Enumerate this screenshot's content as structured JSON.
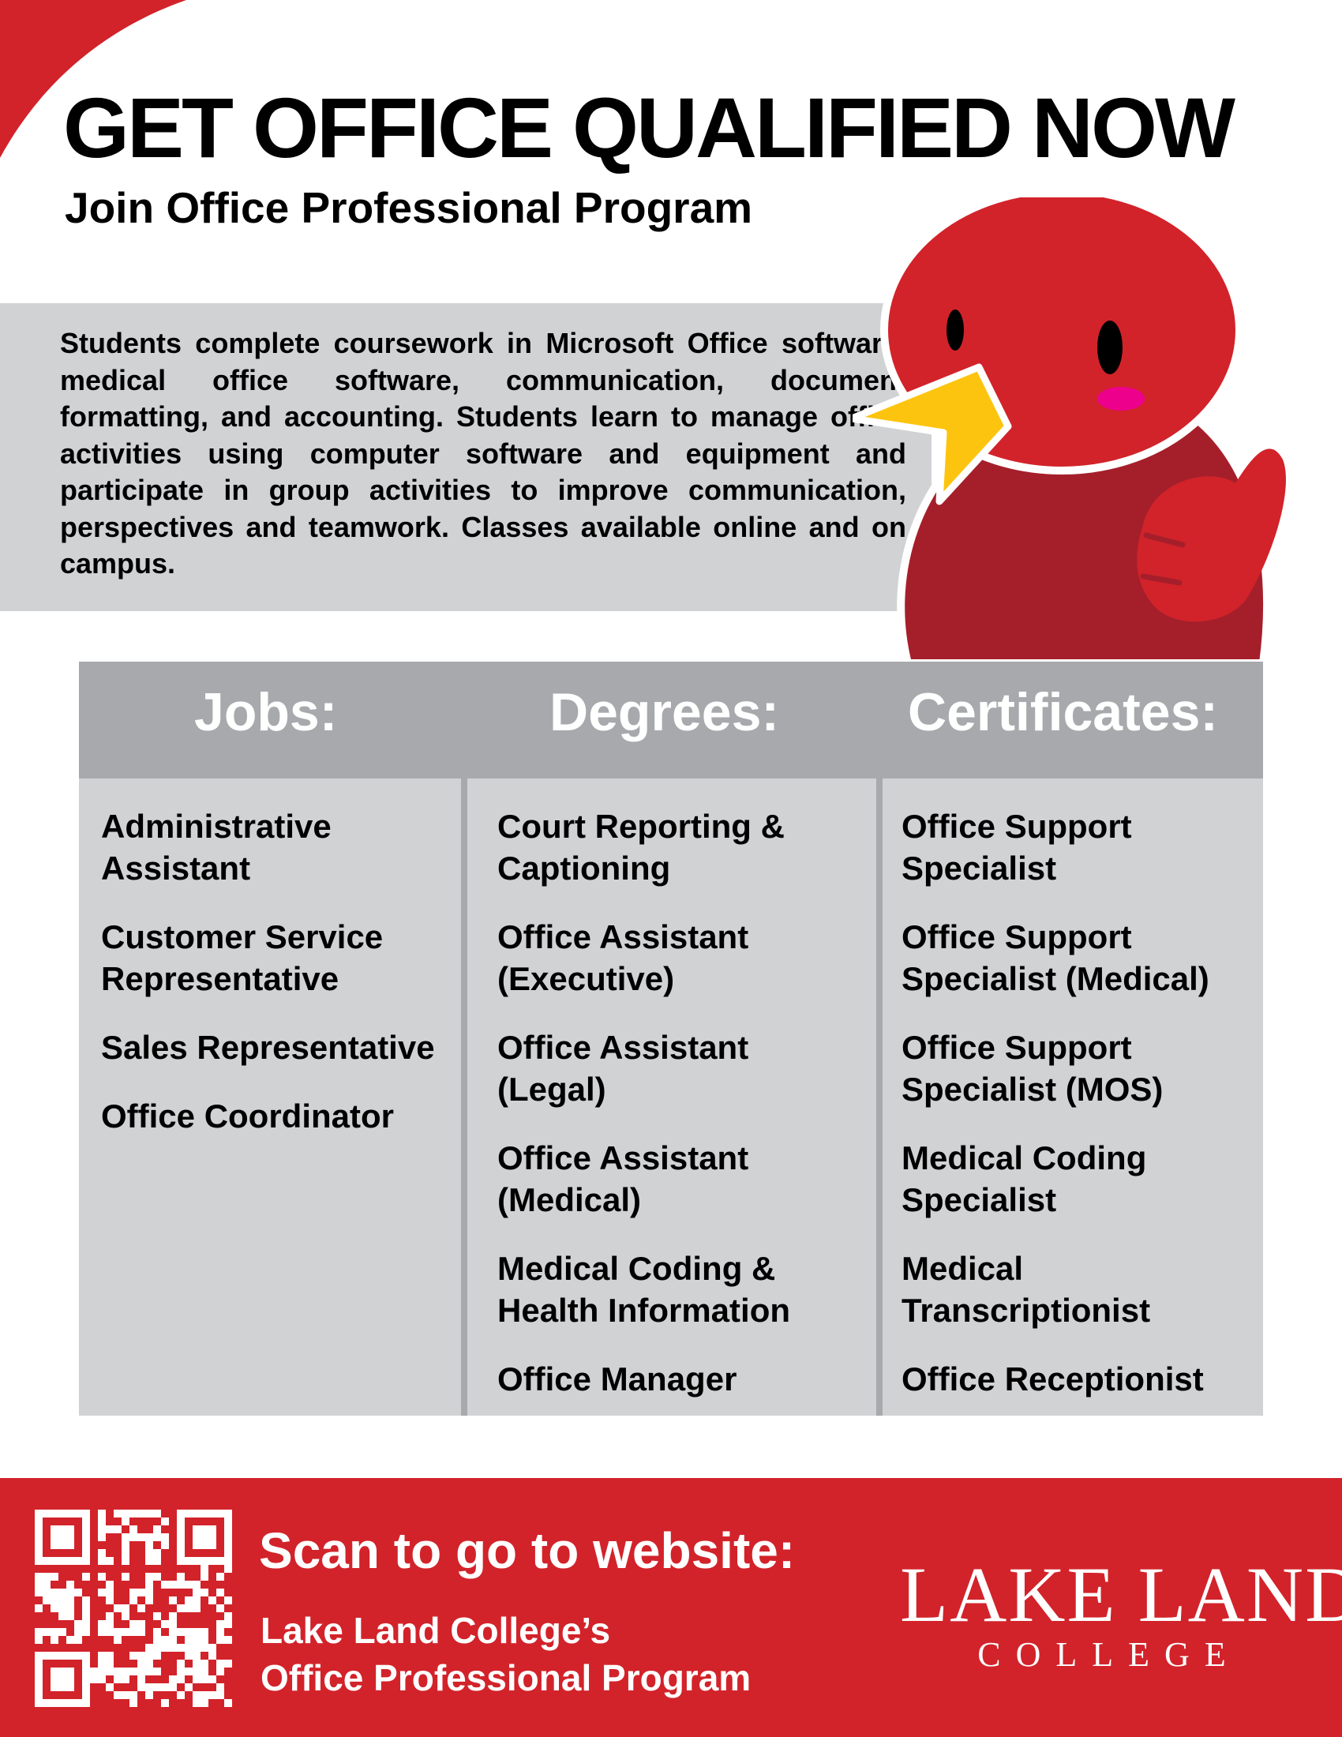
{
  "header": {
    "headline": "GET OFFICE QUALIFIED NOW",
    "subhead": "Join Office Professional Program"
  },
  "intro": {
    "text": "Students complete coursework in Microsoft Office software, medical office software, communication, document formatting, and accounting. Students learn to manage office activities using computer software and equipment and participate in group activities to improve communication, perspectives and teamwork. Classes available online and on campus."
  },
  "columns": {
    "jobs": {
      "title": "Jobs:",
      "items": [
        "Administrative Assistant",
        "Customer Service Representative",
        "Sales Representative",
        "Office Coordinator"
      ]
    },
    "degrees": {
      "title": "Degrees:",
      "items": [
        "Court Reporting & Captioning",
        "Office Assistant (Executive)",
        "Office Assistant (Legal)",
        "Office Assistant (Medical)",
        "Medical Coding & Health Information",
        "Office Manager"
      ]
    },
    "certificates": {
      "title": "Certificates:",
      "items": [
        "Office Support Specialist",
        "Office Support Specialist (Medical)",
        "Office Support Specialist (MOS)",
        "Medical Coding Specialist",
        "Medical Transcriptionist",
        "Office Receptionist"
      ]
    }
  },
  "footer": {
    "scan_label": "Scan to go to website:",
    "program_line1": "Lake Land College’s",
    "program_line2": "Office Professional Program",
    "logo_main": "LAKE LAND",
    "logo_sub": "COLLEGE"
  },
  "colors": {
    "brand_red": "#d2232a",
    "panel_gray": "#d1d2d4",
    "header_gray": "#a7a9ac",
    "mascot_dark_red": "#a51f2b",
    "beak_yellow": "#fdc40f"
  },
  "icons": {
    "mascot": "red-bird-mascot",
    "qr": "qr-code"
  }
}
